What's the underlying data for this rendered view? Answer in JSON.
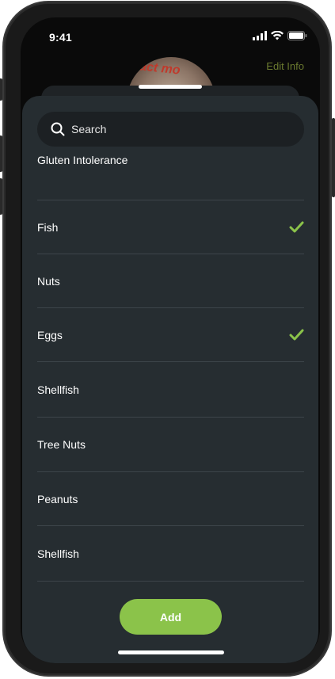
{
  "status": {
    "time": "9:41"
  },
  "header": {
    "edit_label": "Edit Info",
    "avatar_text": "act mo"
  },
  "search": {
    "placeholder": "Search",
    "icon": "search-icon"
  },
  "items": [
    {
      "label": "Gluten Intolerance",
      "checked": false
    },
    {
      "label": "Fish",
      "checked": true
    },
    {
      "label": "Nuts",
      "checked": false
    },
    {
      "label": "Eggs",
      "checked": true
    },
    {
      "label": "Shellfish",
      "checked": false
    },
    {
      "label": "Tree Nuts",
      "checked": false
    },
    {
      "label": "Peanuts",
      "checked": false
    },
    {
      "label": "Shellfish",
      "checked": false
    }
  ],
  "actions": {
    "add_label": "Add"
  },
  "colors": {
    "accent": "#8bc34a",
    "sheet": "#262d31",
    "edit_info": "#6b7a2f"
  }
}
